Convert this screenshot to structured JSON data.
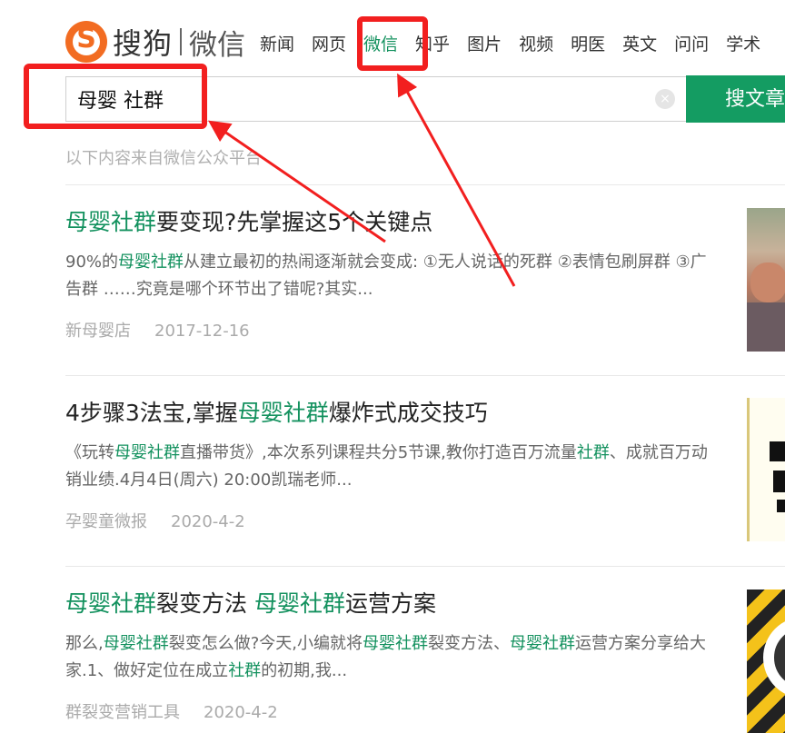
{
  "header": {
    "brand": "搜狗",
    "product": "微信",
    "nav": [
      {
        "label": "新闻",
        "active": false
      },
      {
        "label": "网页",
        "active": false
      },
      {
        "label": "微信",
        "active": true
      },
      {
        "label": "知乎",
        "active": false
      },
      {
        "label": "图片",
        "active": false
      },
      {
        "label": "视频",
        "active": false
      },
      {
        "label": "明医",
        "active": false
      },
      {
        "label": "英文",
        "active": false
      },
      {
        "label": "问问",
        "active": false
      },
      {
        "label": "学术",
        "active": false
      }
    ]
  },
  "search": {
    "value": "母婴 社群",
    "button_label": "搜文章",
    "clear_icon": "×"
  },
  "source_note": "以下内容来自微信公众平台",
  "results": [
    {
      "title": [
        {
          "text": "母婴社群",
          "hl": true
        },
        {
          "text": "要变现?先掌握这5个关键点",
          "hl": false
        }
      ],
      "summary": [
        {
          "text": "90%的",
          "hl": false
        },
        {
          "text": "母婴社群",
          "hl": true
        },
        {
          "text": "从建立最初的热闹逐渐就会变成: ①无人说话的死群 ②表情包刷屏群 ③广告群 ……究竟是哪个环节出了错呢?其实...",
          "hl": false
        }
      ],
      "account": "新母婴店",
      "date": "2017-12-16"
    },
    {
      "title": [
        {
          "text": "4步骤3法宝,掌握",
          "hl": false
        },
        {
          "text": "母婴社群",
          "hl": true
        },
        {
          "text": "爆炸式成交技巧",
          "hl": false
        }
      ],
      "summary": [
        {
          "text": "《玩转",
          "hl": false
        },
        {
          "text": "母婴社群",
          "hl": true
        },
        {
          "text": "直播带货》,本次系列课程共分5节课,教你打造百万流量",
          "hl": false
        },
        {
          "text": "社群",
          "hl": true
        },
        {
          "text": "、成就百万动销业绩.4月4日(周六) 20:00凯瑞老师...",
          "hl": false
        }
      ],
      "account": "孕婴童微报",
      "date": "2020-4-2"
    },
    {
      "title": [
        {
          "text": "母婴社群",
          "hl": true
        },
        {
          "text": "裂变方法 ",
          "hl": false
        },
        {
          "text": "母婴社群",
          "hl": true
        },
        {
          "text": "运营方案",
          "hl": false
        }
      ],
      "summary": [
        {
          "text": "那么,",
          "hl": false
        },
        {
          "text": "母婴社群",
          "hl": true
        },
        {
          "text": "裂变怎么做?今天,小编就将",
          "hl": false
        },
        {
          "text": "母婴社群",
          "hl": true
        },
        {
          "text": "裂变方法、",
          "hl": false
        },
        {
          "text": "母婴社群",
          "hl": true
        },
        {
          "text": "运营方案分享给大家.1、做好定位在成立",
          "hl": false
        },
        {
          "text": "社群",
          "hl": true
        },
        {
          "text": "的初期,我...",
          "hl": false
        }
      ],
      "account": "群裂变营销工具",
      "date": "2020-4-2"
    }
  ],
  "colors": {
    "brand_orange": "#f26c22",
    "highlight_green": "#13915e",
    "button_green": "#149c62",
    "annotation_red": "#f21f1f"
  }
}
